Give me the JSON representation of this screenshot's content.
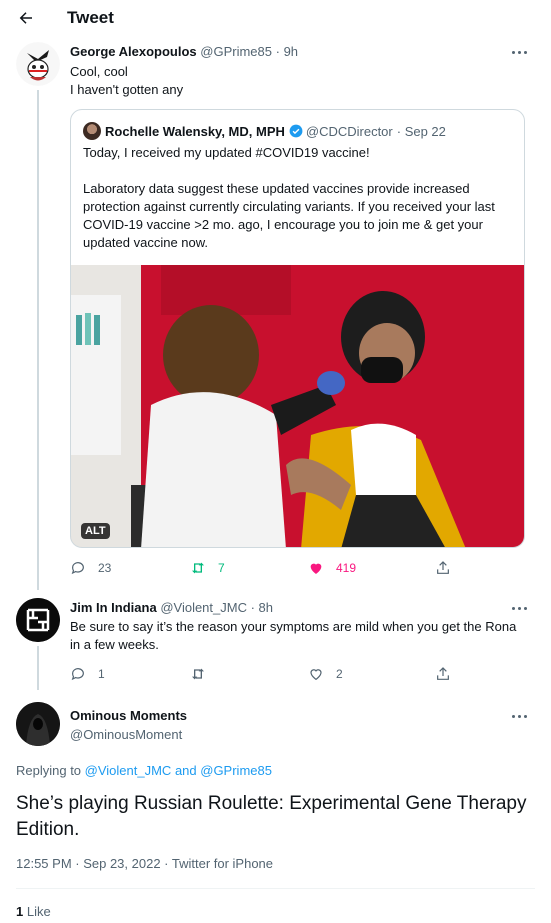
{
  "header": {
    "title": "Tweet"
  },
  "tweets": [
    {
      "name": "George Alexopoulos",
      "handle": "@GPrime85",
      "time": "· 9h",
      "text": "Cool, cool\nI haven't gotten any",
      "quote": {
        "name": "Rochelle Walensky, MD, MPH",
        "handle": "@CDCDirector",
        "time": "· Sep 22",
        "text": "Today, I received my updated #COVID19 vaccine!\n\nLaboratory data suggest these updated vaccines provide increased protection against currently circulating variants. If you received your last COVID-19 vaccine >2 mo. ago, I encourage you to join me & get your updated vaccine now.",
        "alt_label": "ALT"
      },
      "actions": {
        "replies": "23",
        "retweets": "7",
        "likes": "419"
      }
    },
    {
      "name": "Jim In Indiana",
      "handle": "@Violent_JMC",
      "time": "· 8h",
      "text": "Be sure to say it’s the reason your symptoms are mild when you get the Rona in a few weeks.",
      "actions": {
        "replies": "1",
        "retweets": "",
        "likes": "2"
      }
    }
  ],
  "main": {
    "name": "Ominous Moments",
    "handle": "@OminousMoment",
    "replying_prefix": "Replying to ",
    "replying_user1": "@Violent_JMC",
    "replying_and": " and ",
    "replying_user2": "@GPrime85",
    "text": "She’s playing Russian Roulette: Experimental Gene Therapy Edition.",
    "timestamp": "12:55 PM · Sep 23, 2022 · Twitter for iPhone",
    "like_count": "1",
    "like_label": " Like"
  },
  "colors": {
    "accent": "#1d9bf0",
    "like": "#f91880",
    "retweet": "#00ba7c",
    "muted": "#536471"
  },
  "icons": [
    "back-arrow-icon",
    "more-icon",
    "verified-icon",
    "reply-icon",
    "retweet-icon",
    "heart-icon",
    "share-icon"
  ]
}
